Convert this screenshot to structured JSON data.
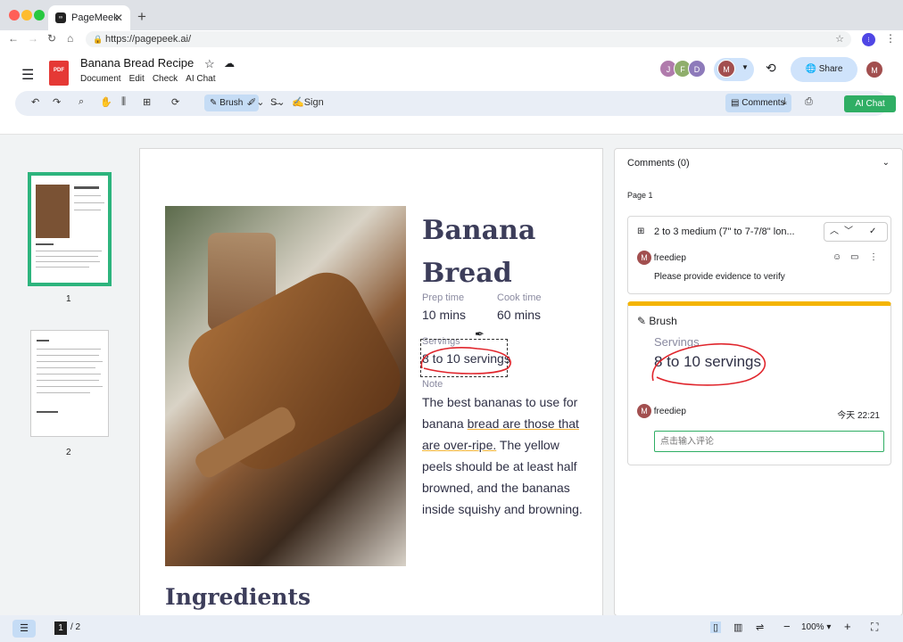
{
  "browser": {
    "tab_title": "PageMeek",
    "url": "https://pagepeek.ai/"
  },
  "app": {
    "doc_title": "Banana Bread Recipe",
    "menu": [
      "Document",
      "Edit",
      "Check",
      "AI Chat"
    ],
    "avatars": [
      "J",
      "F",
      "D"
    ],
    "user_initial": "M",
    "share_label": "Share",
    "toolbar": {
      "brush_label": "Brush",
      "sign_label": "Sign",
      "comments_label": "Comments",
      "ai_chat_label": "AI Chat"
    }
  },
  "thumbnails": {
    "page1": "1",
    "page2": "2"
  },
  "page": {
    "title_line1": "Banana",
    "title_line2": "Bread",
    "prep_label": "Prep time",
    "prep_value": "10 mins",
    "cook_label": "Cook time",
    "cook_value": "60 mins",
    "servings_label": "Servings",
    "servings_value": "8 to 10 servings",
    "note_label": "Note",
    "note_p1": "The best bananas to use for banana ",
    "note_u": "bread are those that are over-ripe.",
    "note_p2": " The yellow peels should be at least half browned, and the bananas inside squishy and browning.",
    "ingredients": "Ingredients"
  },
  "comments": {
    "header": "Comments (0)",
    "page_label": "Page 1",
    "card1_title": "2 to 3 medium (7\" to 7-7/8\" lon...",
    "card1_user": "freediep",
    "card1_text": "Please provide evidence to verify",
    "card2_type": "Brush",
    "card2_servings_label": "Servings",
    "card2_servings_value": "8 to 10 servings",
    "card2_user": "freediep",
    "card2_time": "今天 22:21",
    "input_placeholder": "点击输入评论"
  },
  "footer": {
    "page_current": "1",
    "page_total": "/ 2",
    "zoom": "100%"
  },
  "colors": {
    "accent": "#2fae64",
    "highlight": "#c5dcf5",
    "brush_red": "#e0252c",
    "underline": "#f2b43a"
  }
}
